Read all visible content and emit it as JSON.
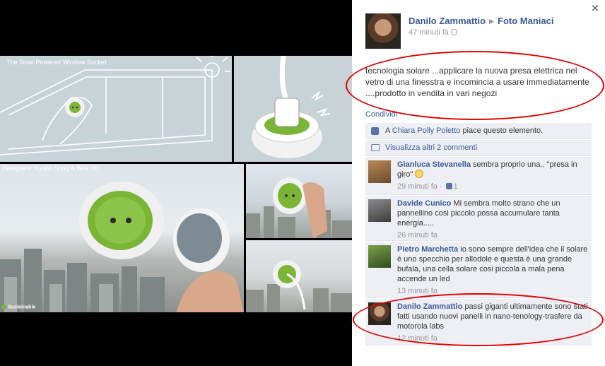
{
  "photo": {
    "caption_top": "The Solar Powered Window Socket",
    "caption_designers": "Designers: Kyuho Song & Boa Oh",
    "watermark": "Sustainable"
  },
  "post": {
    "author": "Danilo Zammattio",
    "target": "Foto Maniaci",
    "timestamp": "47 minuti fa",
    "text": "tecnologia solare ...applicare la nuova presa elettrica nel vetro di una finesstra e incomincia a usare immediatamente ....prodotto in vendita in vari negozi",
    "share_label": "Condividi",
    "likes": {
      "prefix": "A ",
      "liker": "Chiara Polly Poletto",
      "suffix": " piace questo elemento."
    },
    "more_comments": "Visualizza altri 2 commenti"
  },
  "comments": [
    {
      "name": "Gianluca Stevanella",
      "text": " sembra proprio una.. \"presa in giro\" ",
      "time": "29 minuti fa",
      "likes": "1"
    },
    {
      "name": "Davide Cunico",
      "text": " Mi sembra molto strano che un pannellino cosi piccolo possa accumulare tanta energia.....",
      "time": "26 minuti fa"
    },
    {
      "name": "Pietro Marchetta",
      "text": " io sono sempre dell'idea che il solare è uno specchio per allodole e questa è una grande bufala, una cella solare cosi piccola a mala pena accende un led",
      "time": "13 minuti fa"
    },
    {
      "name": "Danilo Zammattio",
      "text": " passi giganti ultimamente sono stati fatti usando nuovi panelli in nano-tenology-trasfere da motorola labs",
      "time": "12 minuti fa"
    }
  ],
  "colors": {
    "link": "#3b5998",
    "annotation": "#e00000",
    "socket_green": "#7bb536"
  }
}
